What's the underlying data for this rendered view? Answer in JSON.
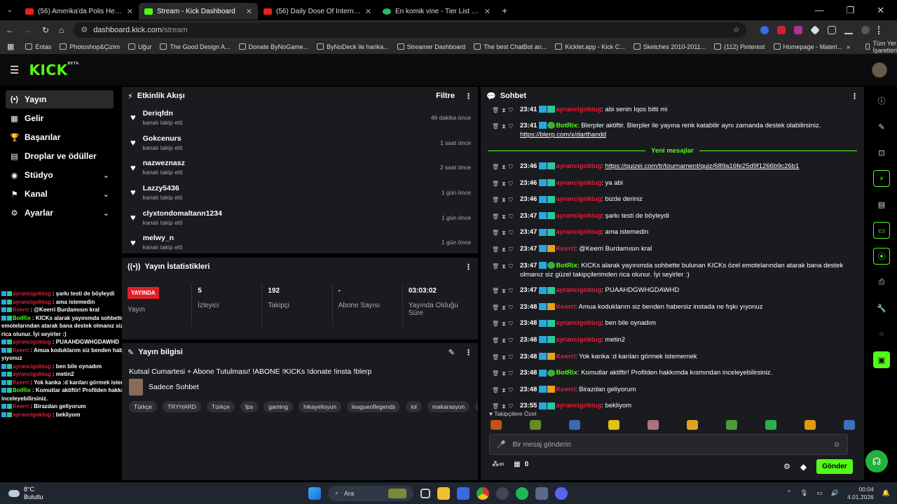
{
  "browser": {
    "tabs": [
      {
        "title": "(56) Amerika'da Polis Her Şeyi Ç",
        "icon": "youtube"
      },
      {
        "title": "Stream - Kick Dashboard",
        "icon": "kick",
        "active": true
      },
      {
        "title": "(56) Daily Dose Of Internet - Yo",
        "icon": "youtube"
      },
      {
        "title": "En komik vine - Tier List | Kör S",
        "icon": "vine"
      }
    ],
    "url_host": "dashboard.kick.com",
    "url_path": "/stream",
    "bookmarks": [
      "Entas",
      "Photoshop&Çizim",
      "Uğur",
      "The Good Design A...",
      "Donate ByNoGame...",
      "ByNoDeck ile harika...",
      "Streamer Dashboard",
      "The best ChatBot an...",
      "Kicklet.app - Kick C...",
      "Sketches 2010-2011...",
      "(112) Pinterest",
      "Homepage - Materi..."
    ],
    "all_bookmarks": "Tüm Yer İşaretleri"
  },
  "header": {
    "logo": "KICK",
    "logo_sup": "BETA"
  },
  "sidebar": {
    "items": [
      {
        "label": "Yayın",
        "icon": "(•)",
        "active": true
      },
      {
        "label": "Gelir",
        "icon": "▦"
      },
      {
        "label": "Başarılar",
        "icon": "🏆"
      },
      {
        "label": "Droplar ve ödüller",
        "icon": "▤"
      },
      {
        "label": "Stüdyo",
        "icon": "◉",
        "expand": true
      },
      {
        "label": "Kanal",
        "icon": "⚑",
        "expand": true
      },
      {
        "label": "Ayarlar",
        "icon": "⚙",
        "expand": true
      }
    ]
  },
  "activity": {
    "title": "Etkinlik Akışı",
    "filter": "Filtre",
    "items": [
      {
        "name": "Deriqfdn",
        "sub": "kanalı takip etti",
        "time": "46 dakika önce"
      },
      {
        "name": "Gokcenurs",
        "sub": "kanalı takip etti",
        "time": "1 saat önce"
      },
      {
        "name": "nazweznasz",
        "sub": "kanalı takip etti",
        "time": "2 saat önce"
      },
      {
        "name": "Lazzy5436",
        "sub": "kanalı takip etti",
        "time": "1 gün önce"
      },
      {
        "name": "clyxtondomaltann1234",
        "sub": "kanalı takip etti",
        "time": "1 gün önce"
      },
      {
        "name": "melwy_n",
        "sub": "kanalı takip etti",
        "time": "1 gün önce"
      }
    ]
  },
  "stats": {
    "title": "Yayın İstatistikleri",
    "live_badge": "YAYINDA",
    "items": [
      {
        "value": "",
        "label": "Yayın"
      },
      {
        "value": "5",
        "label": "İzleyici"
      },
      {
        "value": "192",
        "label": "Takipçi"
      },
      {
        "value": "-",
        "label": "Abone Sayısı"
      },
      {
        "value": "03:03:02",
        "label": "Yayında Olduğu Süre"
      }
    ]
  },
  "stream_info": {
    "title": "Yayın bilgisi",
    "stream_title": "Kutsal Cumartesi + Abone Tutulması! !ABONE !KICKs !donate !insta !blerp",
    "category": "Sadece Sohbet",
    "tags": [
      "Türkçe",
      "TRYHARD",
      "Türkçe",
      "fps",
      "gaming",
      "hikayelioyun",
      "leagueoflegends",
      "lol",
      "makarasyon",
      "tl"
    ]
  },
  "chat": {
    "title": "Sohbet",
    "new_messages": "Yeni mesajlar",
    "messages_before": [
      {
        "time": "23:41",
        "user": "ayrancigoktug",
        "kind": "ay",
        "text": "abi senin Iqos bitti mi"
      },
      {
        "time": "23:41",
        "user": "BotRix",
        "kind": "bot",
        "text": "Blerpler aktiftir. Blerpler ile yayına renk katabilir aynı zamanda destek olabilirsiniz.",
        "link": "https://blerp.com/x/darthandd"
      }
    ],
    "messages_after": [
      {
        "time": "23:46",
        "user": "ayrancigoktug",
        "kind": "ay",
        "text": "",
        "link": "https://quizei.com/tr/tournament/quiz/689a16fe25d9f1266b9c26b1"
      },
      {
        "time": "23:46",
        "user": "ayrancigoktug",
        "kind": "ay",
        "text": "ya abi"
      },
      {
        "time": "23:46",
        "user": "ayrancigoktug",
        "kind": "ay",
        "text": "bizde deriniz"
      },
      {
        "time": "23:47",
        "user": "ayrancigoktug",
        "kind": "ay",
        "text": "şarkı testi de böyleydi"
      },
      {
        "time": "23:47",
        "user": "ayrancigoktug",
        "kind": "ay",
        "text": "ama istemedin"
      },
      {
        "time": "23:47",
        "user": "Keerri",
        "kind": "ke",
        "text": "@Keerri Burdamısın kral"
      },
      {
        "time": "23:47",
        "user": "BotRix",
        "kind": "bot",
        "text": "KICKs alarak yayınımda sohbette bulunan KICKs özel emotelarından atarak bana destek olmanız siz güzel takipçilerimden rica olunur. İyi seyirler :)"
      },
      {
        "time": "23:47",
        "user": "ayrancigoktug",
        "kind": "ay",
        "text": "PUAAHDGWHGDAWHD"
      },
      {
        "time": "23:48",
        "user": "Keerri",
        "kind": "ke",
        "text": "Amua koduklarım siz benden habersiz instada ne fışkı yıyonuz"
      },
      {
        "time": "23:48",
        "user": "ayrancigoktug",
        "kind": "ay",
        "text": "ben bile oynadım"
      },
      {
        "time": "23:48",
        "user": "ayrancigoktug",
        "kind": "ay",
        "text": "metin2"
      },
      {
        "time": "23:48",
        "user": "Keerri",
        "kind": "ke",
        "text": "Yok kanka :d karıları görmek istememek"
      },
      {
        "time": "23:48",
        "user": "BotRix",
        "kind": "bot",
        "text": "Komutlar aktiftir! Profilden hakkımda kısmından inceleyebilirsiniz."
      },
      {
        "time": "23:48",
        "user": "Keerri",
        "kind": "ke",
        "text": "Birazdan geliyorum"
      },
      {
        "time": "23:55",
        "user": "ayrancigoktug",
        "kind": "ay",
        "text": "bekliyom"
      }
    ],
    "emote_label": "Takipçilere Özel",
    "emote_colors": [
      "#c8501c",
      "#6a8a2a",
      "#3a6ab0",
      "#e0c21a",
      "#b07080",
      "#e0a020",
      "#4a9a3a",
      "#2ab04a",
      "#e09a10",
      "#3a70c0"
    ],
    "input_placeholder": "Bir mesaj gönderin",
    "kick_count": "0",
    "send_label": "Gönder"
  },
  "overlay": [
    {
      "user": "ayrancigoktug",
      "kind": "ay",
      "text": "şarkı testi de böyleydi"
    },
    {
      "user": "ayrancigoktug",
      "kind": "ay",
      "text": "ama istemedin"
    },
    {
      "user": "Keerri",
      "kind": "ke",
      "text": "@Keerri Burdamısın kral"
    },
    {
      "user": "BotRix",
      "kind": "bot",
      "text": "KICKs alarak yayınımda sohbette bulunan KICKs özel emotelarından atarak bana destek olmanız siz güzel takipçilerimden rica olunur. İyi seyirler :)"
    },
    {
      "user": "ayrancigoktug",
      "kind": "ay",
      "text": "PUAAHDGWHGDAWHD"
    },
    {
      "user": "Keerri",
      "kind": "ke",
      "text": "Amua koduklarım siz benden habersiz instada ne fışkı yıyonuz"
    },
    {
      "user": "ayrancigoktug",
      "kind": "ay",
      "text": "ben bile oynadım"
    },
    {
      "user": "ayrancigoktug",
      "kind": "ay",
      "text": "metin2"
    },
    {
      "user": "Keerri",
      "kind": "ke",
      "text": "Yok kanka :d karıları görmek istememek"
    },
    {
      "user": "BotRix",
      "kind": "bot",
      "text": "Komutlar aktiftir! Profilden hakkımda kısmından inceleyebilirsiniz."
    },
    {
      "user": "Keerri",
      "kind": "ke",
      "text": "Birazdan geliyorum"
    },
    {
      "user": "ayrancigoktug",
      "kind": "ay",
      "text": "bekliyom"
    }
  ],
  "taskbar": {
    "temp": "8°C",
    "weather": "Bulutlu",
    "search": "Ara",
    "time": "00:04",
    "date": "4.01.2026"
  }
}
